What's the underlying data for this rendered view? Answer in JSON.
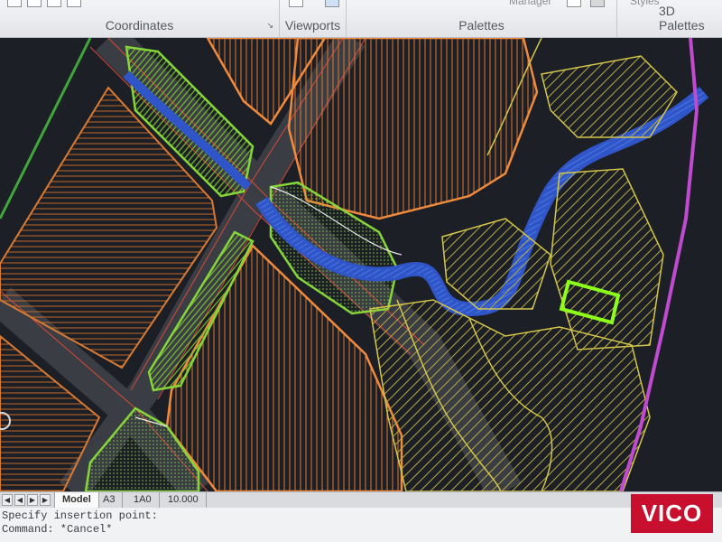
{
  "ribbon": {
    "panels": [
      {
        "title": "Coordinates"
      },
      {
        "title": "Viewports"
      },
      {
        "title": "Palettes"
      },
      {
        "title": "3D Palettes"
      }
    ],
    "top_labels": {
      "manager": "Manager",
      "styles": "Styles"
    }
  },
  "layout_tabs": {
    "items": [
      "Model",
      "A3",
      "1A0",
      "10.000"
    ],
    "active": "Model"
  },
  "command_line": {
    "history": "Specify insertion point:",
    "current": "Command: *Cancel*"
  },
  "watermark": {
    "text": "VICO"
  },
  "colors": {
    "background": "#1c1f25",
    "orange_parcel": "#f08a3c",
    "green_strip": "#86d63a",
    "yellow_hatch": "#d4c64a",
    "river_blue": "#3a63d8",
    "road_red": "#d44a3a",
    "boundary_magenta": "#c04ad0",
    "highlight_lime": "#8cff1a"
  },
  "icons": {
    "pan": "pan-icon",
    "first_tab": "first-tab-icon",
    "prev_tab": "prev-tab-icon",
    "next_tab": "next-tab-icon",
    "last_tab": "last-tab-icon"
  }
}
